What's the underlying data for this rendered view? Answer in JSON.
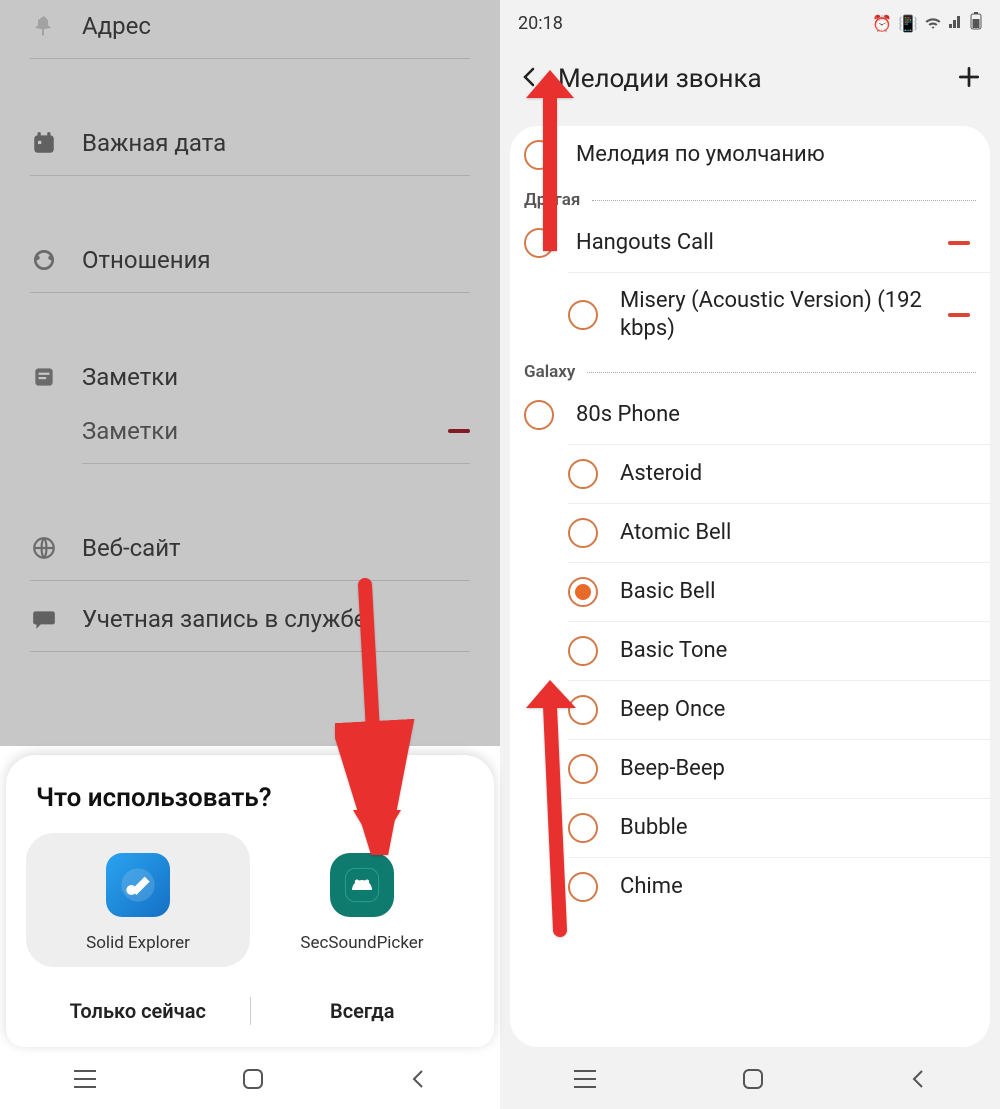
{
  "left": {
    "fields": {
      "address": "Адрес",
      "important_date": "Важная дата",
      "relations": "Отношения",
      "notes": "Заметки",
      "notes_sub": "Заметки",
      "website": "Веб-сайт",
      "account": "Учетная запись в службе"
    },
    "chooser": {
      "title": "Что использовать?",
      "apps": [
        {
          "label": "Solid Explorer"
        },
        {
          "label": "SecSoundPicker"
        }
      ],
      "buttons": {
        "once": "Только сейчас",
        "always": "Всегда"
      }
    }
  },
  "right": {
    "status_time": "20:18",
    "title": "Мелодии звонка",
    "default_label": "Мелодия по умолчанию",
    "sections": {
      "other": "Другая",
      "galaxy": "Galaxy"
    },
    "other_items": [
      {
        "label": "Hangouts Call",
        "removable": true
      },
      {
        "label": "Misery (Acoustic Version) (192  kbps)",
        "removable": true
      }
    ],
    "galaxy_items": [
      {
        "label": "80s Phone",
        "selected": false
      },
      {
        "label": "Asteroid",
        "selected": false
      },
      {
        "label": "Atomic Bell",
        "selected": false
      },
      {
        "label": "Basic Bell",
        "selected": true
      },
      {
        "label": "Basic Tone",
        "selected": false
      },
      {
        "label": "Beep Once",
        "selected": false
      },
      {
        "label": "Beep-Beep",
        "selected": false
      },
      {
        "label": "Bubble",
        "selected": false
      },
      {
        "label": "Chime",
        "selected": false
      }
    ]
  }
}
